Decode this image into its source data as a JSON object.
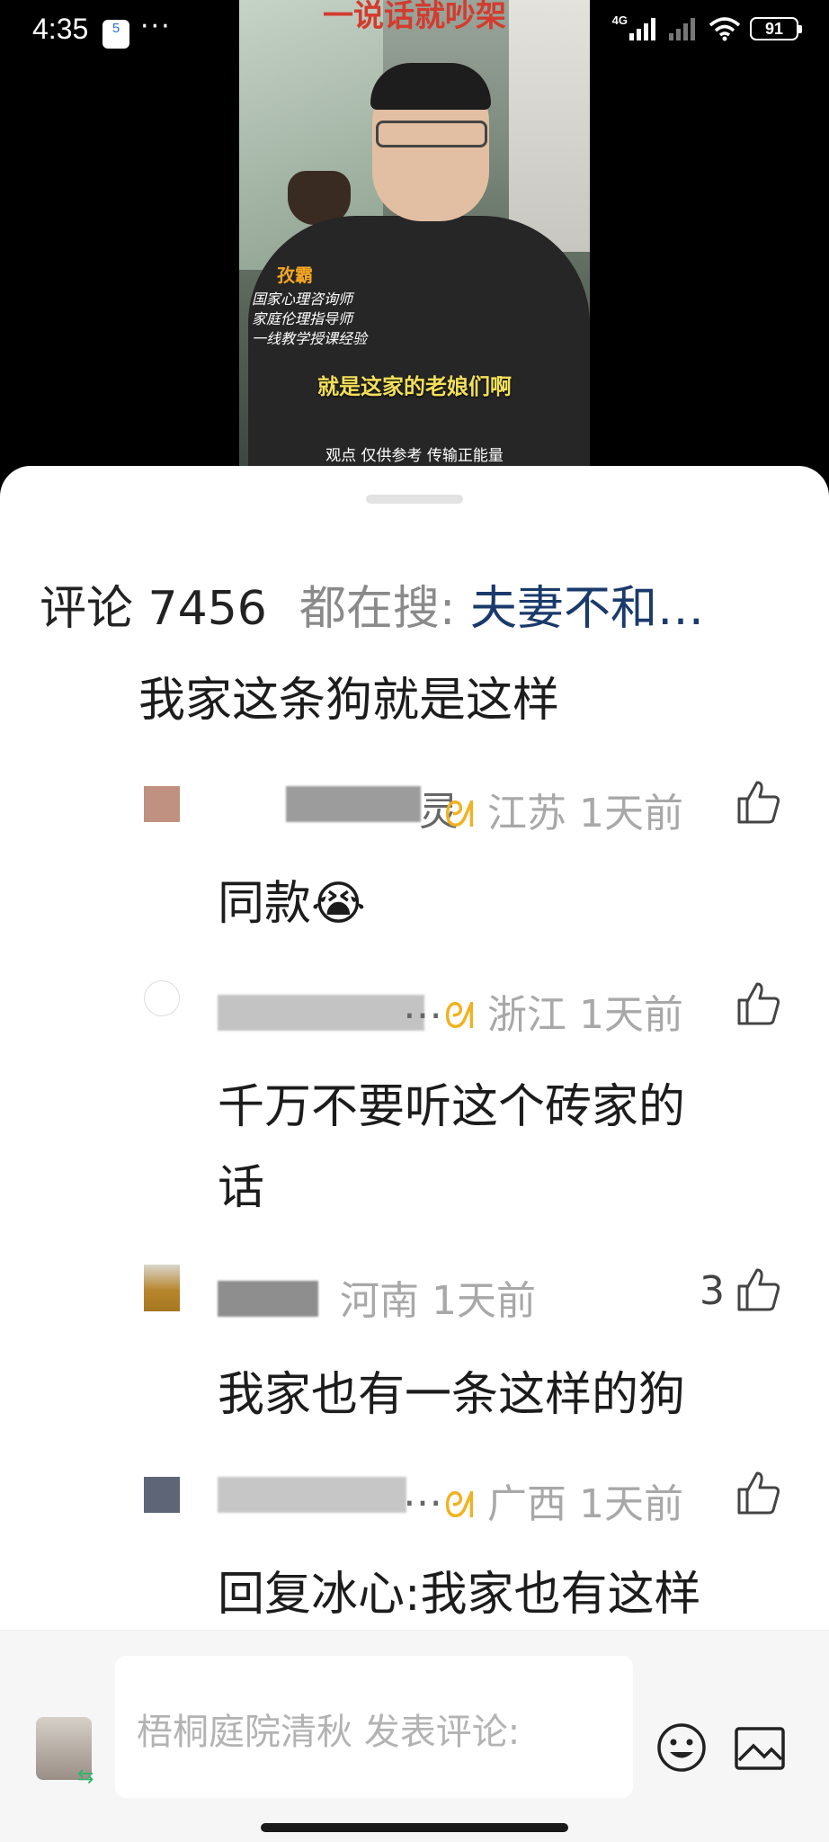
{
  "status_bar": {
    "time": "4:35",
    "app_badge": "5",
    "overflow": "···",
    "network": "4G",
    "battery": "91"
  },
  "video": {
    "title": "一说话就吵架",
    "host_name": "孜霸",
    "credentials": [
      "国家心理咨询师",
      "家庭伦理指导师",
      "一线教学授课经验"
    ],
    "subtitle": "就是这家的老娘们啊",
    "footer": "观点 仅供参考 传输正能量"
  },
  "comments_header": {
    "label": "评论 7456",
    "search_prefix": "都在搜:",
    "search_term": "夫妻不和…"
  },
  "top_comment": {
    "text": "我家这条狗就是这样"
  },
  "replies": [
    {
      "name_tail": "灵",
      "region": "江苏 1天前",
      "text": "同款😭",
      "likes": ""
    },
    {
      "name_tail": "…",
      "region": "浙江 1天前",
      "text_line1": "千万不要听这个砖家的",
      "text_line2": "话",
      "likes": ""
    },
    {
      "name_tail": "",
      "region": "河南 1天前",
      "text": "我家也有一条这样的狗",
      "likes": "3"
    },
    {
      "name_tail": "…",
      "region": "广西 1天前",
      "text": "回复冰心:我家也有这样",
      "likes": ""
    }
  ],
  "input_bar": {
    "placeholder": "梧桐庭院清秋 发表评论:"
  }
}
